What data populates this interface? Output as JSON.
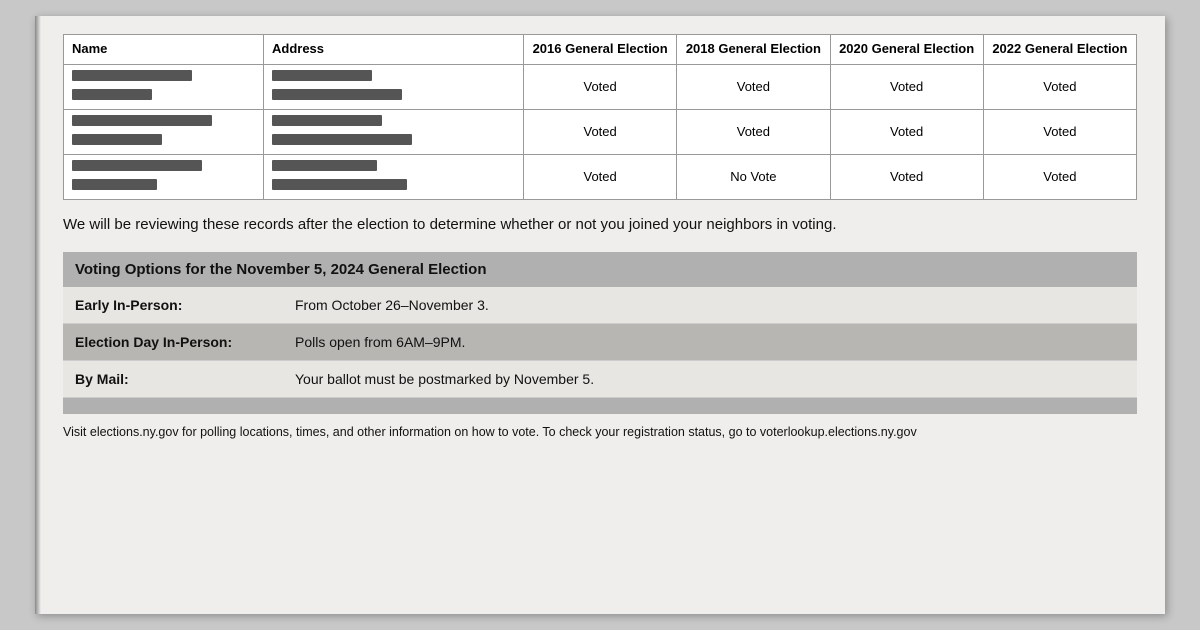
{
  "table": {
    "headers": {
      "name": "Name",
      "address": "Address",
      "col2016": "2016 General Election",
      "col2018": "2018 General Election",
      "col2020": "2020 General Election",
      "col2022": "2022 General Election"
    },
    "rows": [
      {
        "name_lines": [
          120,
          80
        ],
        "address_lines": [
          100,
          130
        ],
        "v2016": "Voted",
        "v2018": "Voted",
        "v2020": "Voted",
        "v2022": "Voted"
      },
      {
        "name_lines": [
          140,
          90
        ],
        "address_lines": [
          110,
          140
        ],
        "v2016": "Voted",
        "v2018": "Voted",
        "v2020": "Voted",
        "v2022": "Voted"
      },
      {
        "name_lines": [
          130,
          85
        ],
        "address_lines": [
          105,
          135
        ],
        "v2016": "Voted",
        "v2018": "No Vote",
        "v2020": "Voted",
        "v2022": "Voted"
      }
    ]
  },
  "review_text": "We will be reviewing these records after the election to determine whether or not you joined your neighbors in voting.",
  "voting_options": {
    "section_title": "Voting Options for the November 5, 2024 General Election",
    "options": [
      {
        "label": "Early In-Person:",
        "value": "From October 26–November 3."
      },
      {
        "label": "Election Day In-Person:",
        "value": "Polls open from 6AM–9PM."
      },
      {
        "label": "By Mail:",
        "value": "Your ballot must be postmarked by November 5."
      }
    ]
  },
  "footer": {
    "text": "Visit elections.ny.gov for polling locations, times, and other information on how to vote. To check your registration status, go to voterlookup.elections.ny.gov"
  }
}
